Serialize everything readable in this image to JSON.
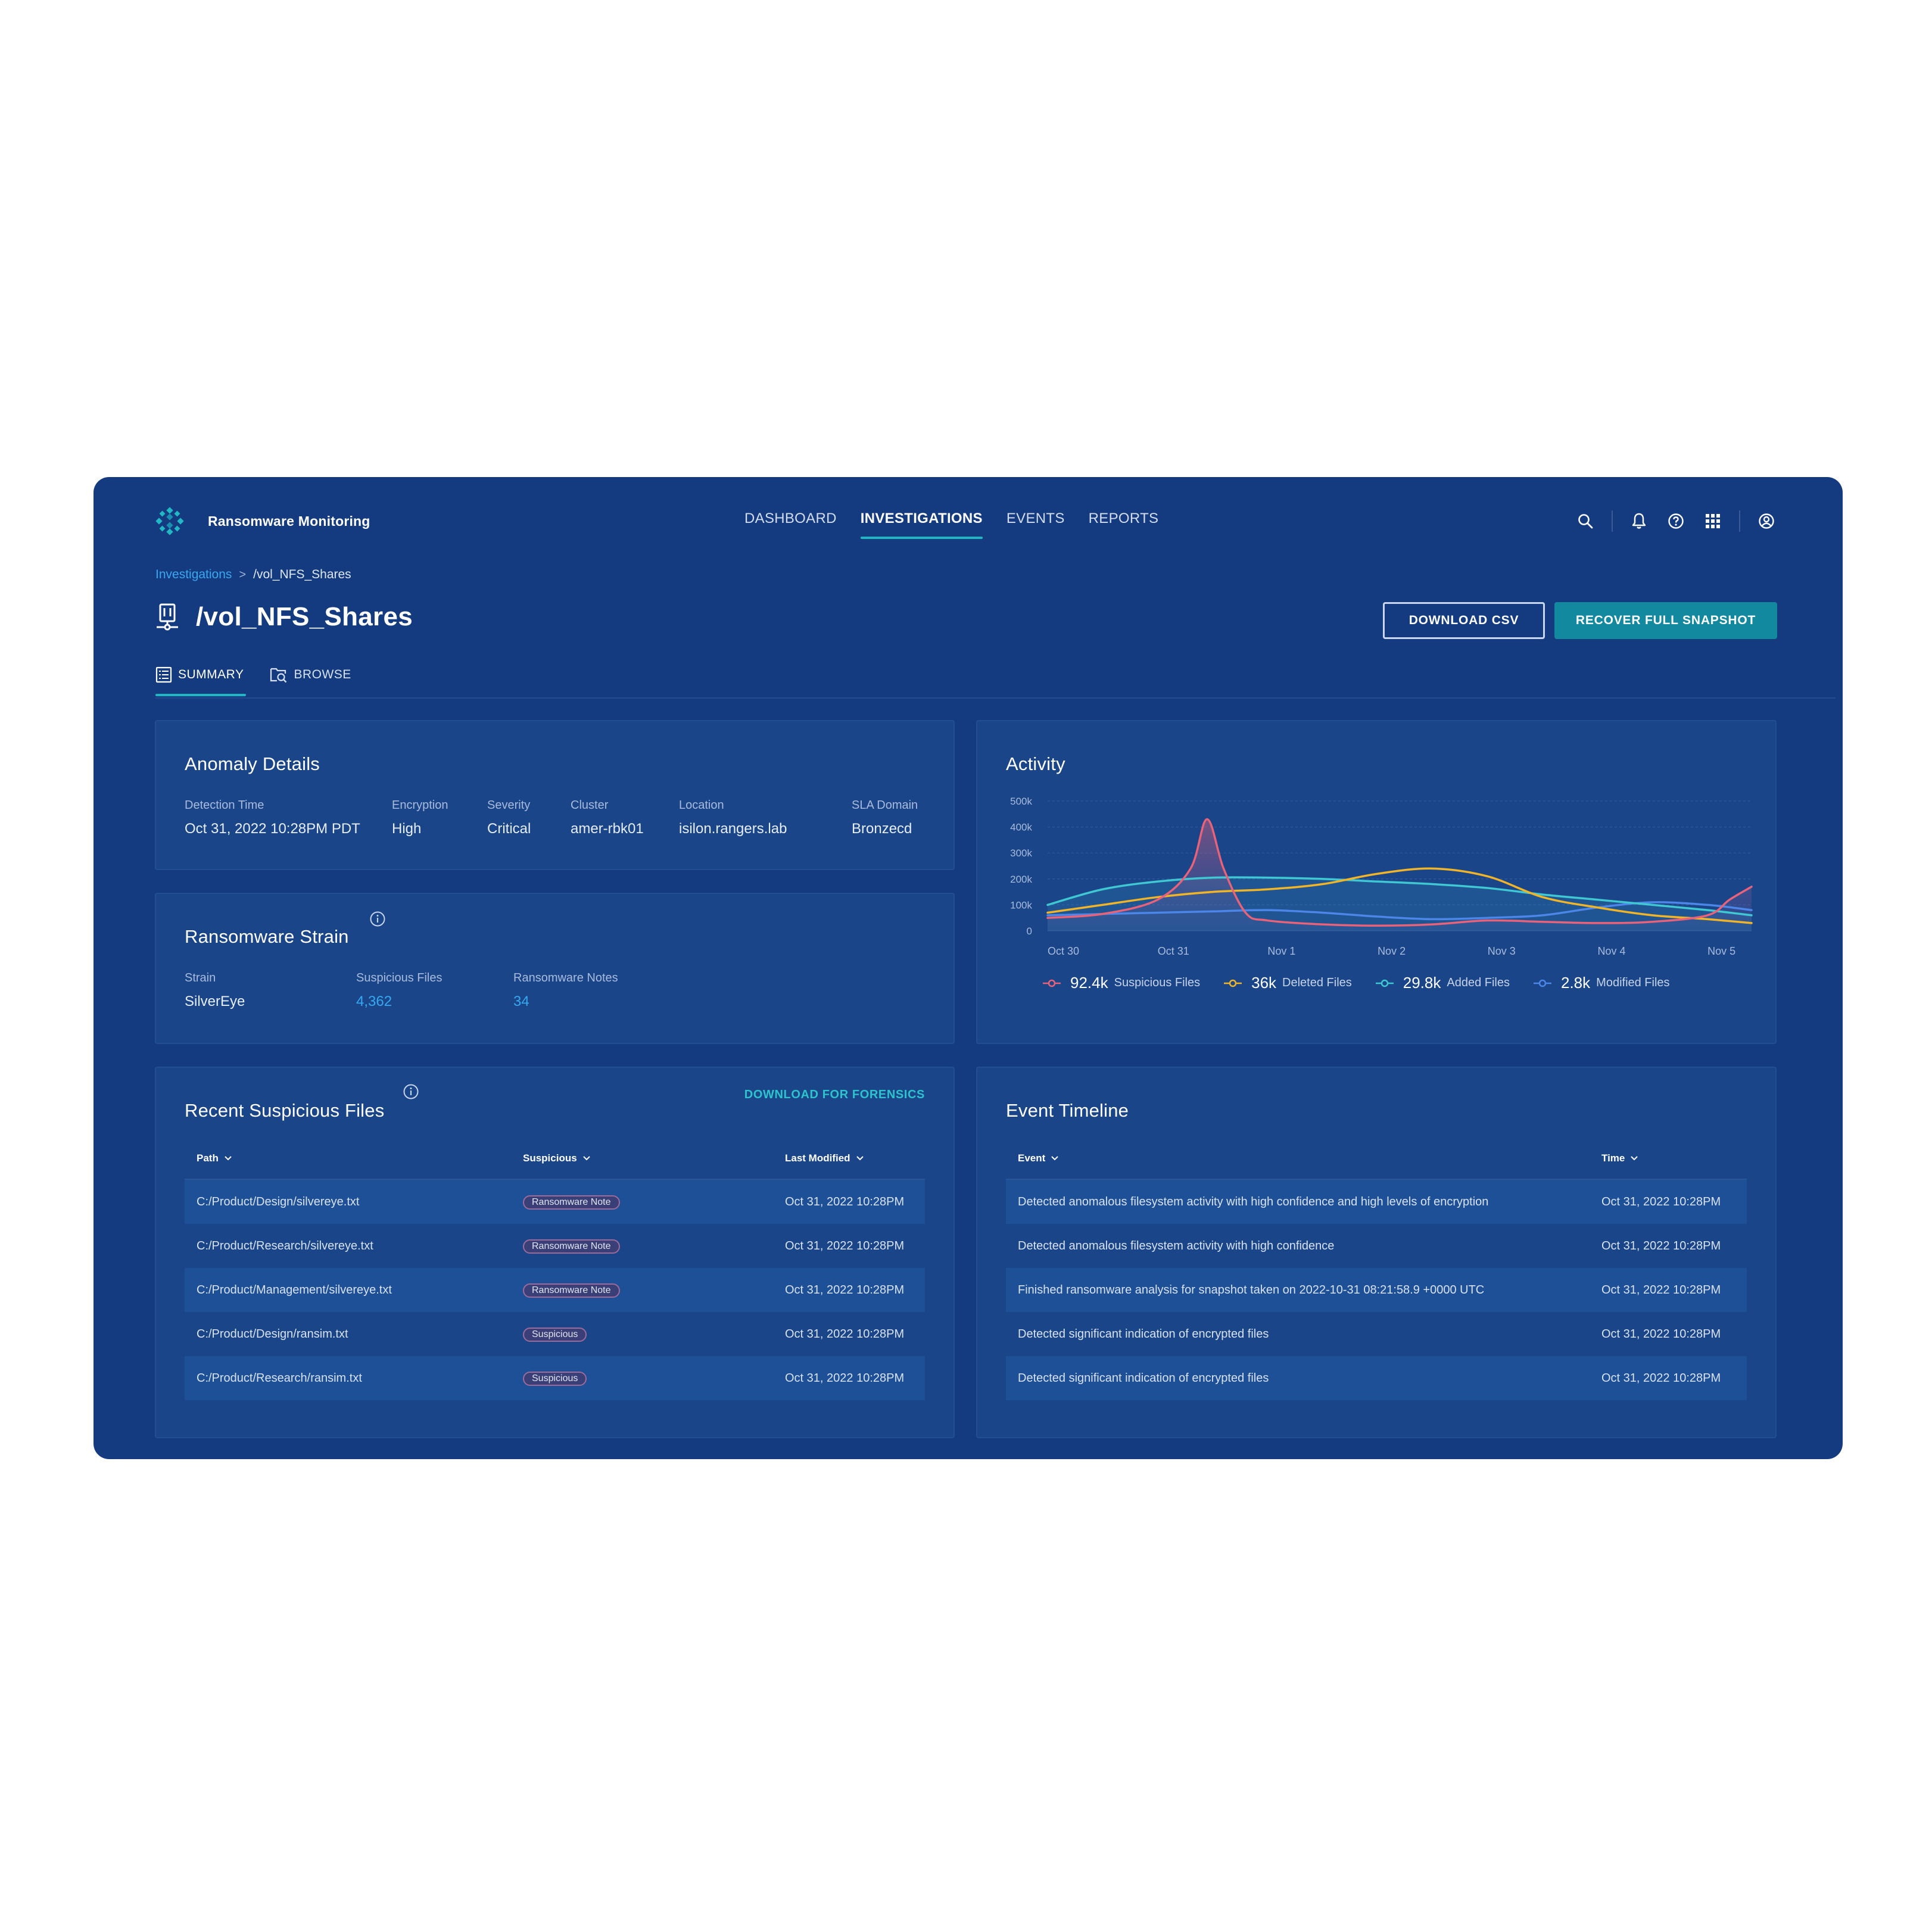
{
  "app": {
    "name": "Ransomware Monitoring"
  },
  "nav": {
    "items": [
      {
        "label": "DASHBOARD"
      },
      {
        "label": "INVESTIGATIONS"
      },
      {
        "label": "EVENTS"
      },
      {
        "label": "REPORTS"
      }
    ],
    "active": "INVESTIGATIONS"
  },
  "top_icons": [
    "search-icon",
    "bell-icon",
    "help-icon",
    "apps-grid-icon",
    "user-icon"
  ],
  "breadcrumb": {
    "parent": "Investigations",
    "separator": ">",
    "current": "/vol_NFS_Shares"
  },
  "page": {
    "title": "/vol_NFS_Shares",
    "icon": "nfs-share-icon"
  },
  "actions": {
    "download_csv": "DOWNLOAD CSV",
    "recover_snapshot": "RECOVER FULL SNAPSHOT"
  },
  "tabs": [
    {
      "label": "SUMMARY",
      "icon": "list-icon",
      "active": true
    },
    {
      "label": "BROWSE",
      "icon": "browse-search-icon",
      "active": false
    }
  ],
  "anomaly": {
    "title": "Anomaly Details",
    "fields": [
      {
        "label": "Detection Time",
        "value": "Oct 31, 2022 10:28PM PDT"
      },
      {
        "label": "Encryption",
        "value": "High"
      },
      {
        "label": "Severity",
        "value": "Critical"
      },
      {
        "label": "Cluster",
        "value": "amer-rbk01"
      },
      {
        "label": "Location",
        "value": "isilon.rangers.lab"
      },
      {
        "label": "SLA Domain",
        "value": "Bronzecd"
      }
    ]
  },
  "strain": {
    "title": "Ransomware Strain",
    "fields": [
      {
        "label": "Strain",
        "value": "SilverEye"
      },
      {
        "label": "Suspicious Files",
        "value": "4,362"
      },
      {
        "label": "Ransomware Notes",
        "value": "34"
      }
    ]
  },
  "suspicious_files": {
    "title": "Recent Suspicious Files",
    "download_link": "DOWNLOAD FOR FORENSICS",
    "columns": [
      "Path",
      "Suspicious",
      "Last Modified"
    ],
    "rows": [
      {
        "path": "C:/Product/Design/silvereye.txt",
        "tag": "Ransomware Note",
        "modified": "Oct 31, 2022 10:28PM"
      },
      {
        "path": "C:/Product/Research/silvereye.txt",
        "tag": "Ransomware Note",
        "modified": "Oct 31, 2022 10:28PM"
      },
      {
        "path": "C:/Product/Management/silvereye.txt",
        "tag": "Ransomware Note",
        "modified": "Oct 31, 2022 10:28PM"
      },
      {
        "path": "C:/Product/Design/ransim.txt",
        "tag": "Suspicious",
        "modified": "Oct 31, 2022 10:28PM"
      },
      {
        "path": "C:/Product/Research/ransim.txt",
        "tag": "Suspicious",
        "modified": "Oct 31, 2022 10:28PM"
      }
    ]
  },
  "timeline": {
    "title": "Event Timeline",
    "columns": [
      "Event",
      "Time"
    ],
    "rows": [
      {
        "event": "Detected anomalous filesystem activity with high confidence and high levels of encryption",
        "time": "Oct 31, 2022 10:28PM"
      },
      {
        "event": "Detected anomalous filesystem activity with high confidence",
        "time": "Oct 31, 2022 10:28PM"
      },
      {
        "event": "Finished ransomware analysis for snapshot taken on 2022-10-31 08:21:58.9 +0000 UTC",
        "time": "Oct 31, 2022 10:28PM"
      },
      {
        "event": "Detected significant indication of encrypted files",
        "time": "Oct 31, 2022 10:28PM"
      },
      {
        "event": "Detected significant indication of encrypted files",
        "time": "Oct 31, 2022 10:28PM"
      }
    ]
  },
  "activity": {
    "title": "Activity",
    "legend": [
      {
        "value": "92.4k",
        "label": "Suspicious Files",
        "color": "#e8627a"
      },
      {
        "value": "36k",
        "label": "Deleted Files",
        "color": "#f0b429"
      },
      {
        "value": "29.8k",
        "label": "Added Files",
        "color": "#3fc7d3"
      },
      {
        "value": "2.8k",
        "label": "Modified Files",
        "color": "#4b86e8"
      }
    ]
  },
  "chart_data": {
    "type": "line",
    "title": "Activity",
    "x_ticks": [
      "Oct 30",
      "Oct 31",
      "Nov 1",
      "Nov 2",
      "Nov 3",
      "Nov 4",
      "Nov 5"
    ],
    "y_ticks": [
      "0",
      "100k",
      "200k",
      "300k",
      "400k",
      "500k"
    ],
    "xlim": [
      0,
      6.4
    ],
    "ylim": [
      0,
      500000
    ],
    "grid": true,
    "legend_position": "bottom",
    "series": [
      {
        "name": "Suspicious Files",
        "color": "#e8627a",
        "x": [
          0,
          0.5,
          1.0,
          1.3,
          1.45,
          1.6,
          1.8,
          2.0,
          2.5,
          3.0,
          3.5,
          4.0,
          4.5,
          5.0,
          5.5,
          6.0,
          6.2,
          6.4
        ],
        "y": [
          50000,
          65000,
          120000,
          240000,
          430000,
          240000,
          70000,
          40000,
          25000,
          20000,
          25000,
          40000,
          35000,
          30000,
          35000,
          60000,
          120000,
          170000
        ]
      },
      {
        "name": "Deleted Files",
        "color": "#f0b429",
        "x": [
          0,
          0.5,
          1.0,
          1.5,
          2.0,
          2.5,
          3.0,
          3.5,
          4.0,
          4.5,
          5.0,
          5.5,
          6.0,
          6.4
        ],
        "y": [
          70000,
          100000,
          130000,
          150000,
          160000,
          180000,
          220000,
          240000,
          210000,
          130000,
          90000,
          60000,
          45000,
          30000
        ]
      },
      {
        "name": "Added Files",
        "color": "#3fc7d3",
        "x": [
          0,
          0.5,
          1.0,
          1.5,
          2.0,
          2.5,
          3.0,
          3.5,
          4.0,
          4.5,
          5.0,
          5.5,
          6.0,
          6.4
        ],
        "y": [
          100000,
          160000,
          190000,
          205000,
          205000,
          200000,
          190000,
          180000,
          165000,
          140000,
          120000,
          100000,
          80000,
          60000
        ]
      },
      {
        "name": "Modified Files",
        "color": "#4b86e8",
        "x": [
          0,
          0.5,
          1.0,
          1.5,
          2.0,
          2.5,
          3.0,
          3.5,
          4.0,
          4.5,
          5.0,
          5.5,
          6.0,
          6.4
        ],
        "y": [
          60000,
          65000,
          70000,
          75000,
          80000,
          70000,
          55000,
          45000,
          50000,
          60000,
          90000,
          110000,
          100000,
          80000
        ]
      }
    ]
  }
}
